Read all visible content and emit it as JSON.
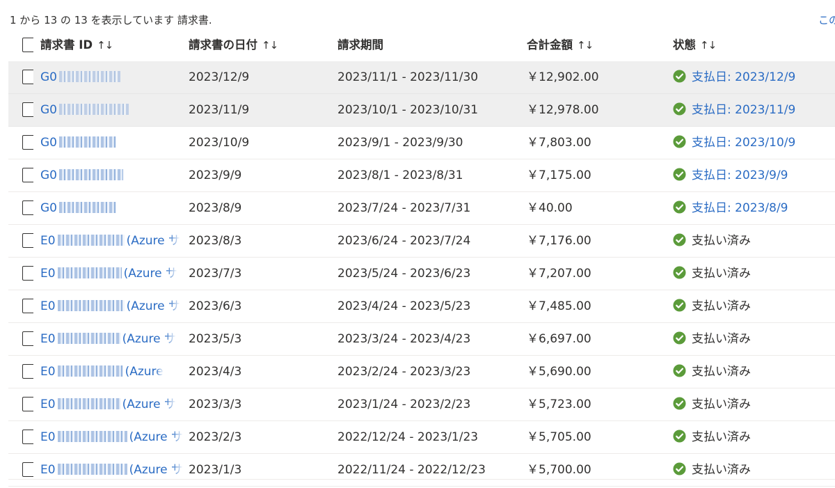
{
  "summary_text": "1 から 13 の 13 を表示しています 請求書.",
  "top_right_link": "この",
  "columns": {
    "id": "請求書 ID",
    "date": "請求書の日付",
    "period": "請求期間",
    "total": "合計金額",
    "status": "状態",
    "sort_glyph": "↑↓"
  },
  "invoices": [
    {
      "id_prefix": "G0",
      "id_suffix": "",
      "date": "2023/12/9",
      "period": "2023/11/1 - 2023/11/30",
      "total": "￥12,902.00",
      "status": "支払日: 2023/12/9",
      "status_kind": "link"
    },
    {
      "id_prefix": "G0",
      "id_suffix": "",
      "date": "2023/11/9",
      "period": "2023/10/1 - 2023/10/31",
      "total": "￥12,978.00",
      "status": "支払日: 2023/11/9",
      "status_kind": "link"
    },
    {
      "id_prefix": "G0",
      "id_suffix": "",
      "date": "2023/10/9",
      "period": "2023/9/1 - 2023/9/30",
      "total": "￥7,803.00",
      "status": "支払日: 2023/10/9",
      "status_kind": "link"
    },
    {
      "id_prefix": "G0",
      "id_suffix": "",
      "date": "2023/9/9",
      "period": "2023/8/1 - 2023/8/31",
      "total": "￥7,175.00",
      "status": "支払日: 2023/9/9",
      "status_kind": "link"
    },
    {
      "id_prefix": "G0",
      "id_suffix": "",
      "date": "2023/8/9",
      "period": "2023/7/24 - 2023/7/31",
      "total": "￥40.00",
      "status": "支払日: 2023/8/9",
      "status_kind": "link"
    },
    {
      "id_prefix": "E0",
      "id_suffix": "(Azure サ",
      "date": "2023/8/3",
      "period": "2023/6/24 - 2023/7/24",
      "total": "￥7,176.00",
      "status": "支払い済み",
      "status_kind": "text"
    },
    {
      "id_prefix": "E0",
      "id_suffix": "(Azure サ",
      "date": "2023/7/3",
      "period": "2023/5/24 - 2023/6/23",
      "total": "￥7,207.00",
      "status": "支払い済み",
      "status_kind": "text"
    },
    {
      "id_prefix": "E0",
      "id_suffix": "(Azure サ",
      "date": "2023/6/3",
      "period": "2023/4/24 - 2023/5/23",
      "total": "￥7,485.00",
      "status": "支払い済み",
      "status_kind": "text"
    },
    {
      "id_prefix": "E0",
      "id_suffix": "(Azure サ",
      "date": "2023/5/3",
      "period": "2023/3/24 - 2023/4/23",
      "total": "￥6,697.00",
      "status": "支払い済み",
      "status_kind": "text"
    },
    {
      "id_prefix": "E0",
      "id_suffix": "(Azure",
      "date": "2023/4/3",
      "period": "2023/2/24 - 2023/3/23",
      "total": "￥5,690.00",
      "status": "支払い済み",
      "status_kind": "text"
    },
    {
      "id_prefix": "E0",
      "id_suffix": "(Azure サ",
      "date": "2023/3/3",
      "period": "2023/1/24 - 2023/2/23",
      "total": "￥5,723.00",
      "status": "支払い済み",
      "status_kind": "text"
    },
    {
      "id_prefix": "E0",
      "id_suffix": "(Azure サ",
      "date": "2023/2/3",
      "period": "2022/12/24 - 2023/1/23",
      "total": "￥5,705.00",
      "status": "支払い済み",
      "status_kind": "text"
    },
    {
      "id_prefix": "E0",
      "id_suffix": "(Azure サ",
      "date": "2023/1/3",
      "period": "2022/11/24 - 2022/12/23",
      "total": "￥5,700.00",
      "status": "支払い済み",
      "status_kind": "text"
    }
  ],
  "selected_rows": [
    0,
    1
  ],
  "colors": {
    "link": "#2b6cc4",
    "status_ok": "#5b9b3a",
    "selected_bg": "#efefef"
  },
  "icons": {
    "status": "check-circle-icon",
    "checkbox": "checkbox-icon"
  }
}
